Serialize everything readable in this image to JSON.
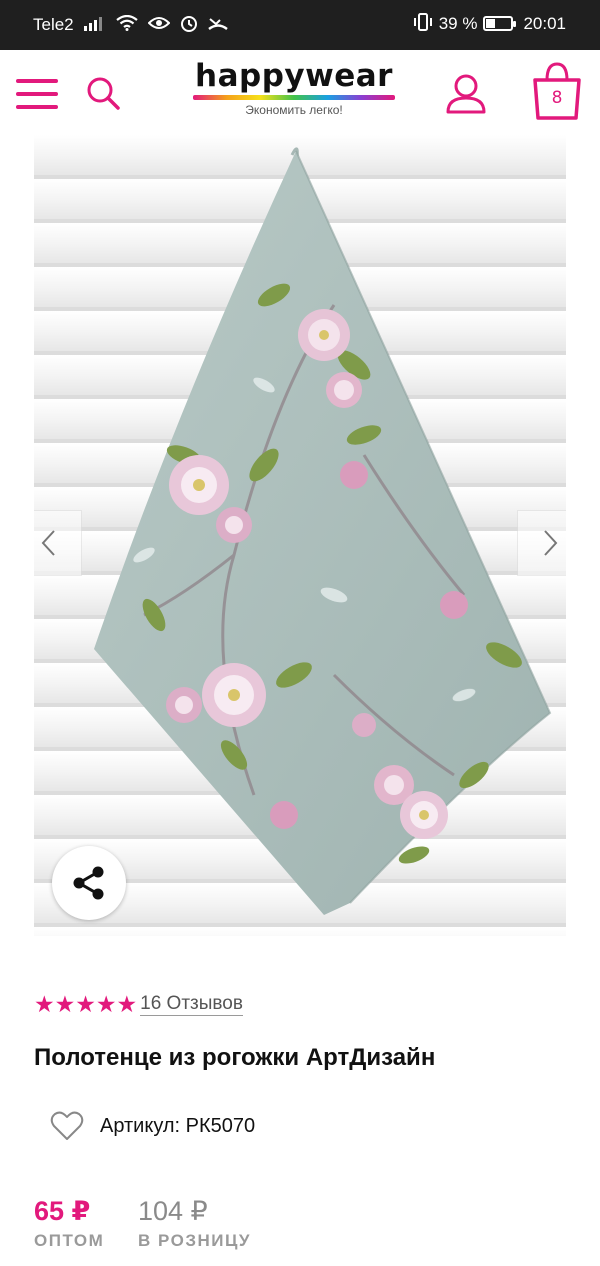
{
  "status_bar": {
    "carrier": "Tele2",
    "battery": "39 %",
    "battery_level": 0.39,
    "time": "20:01",
    "icons": [
      "signal-icon",
      "wifi-icon",
      "eye-comfort-icon",
      "alarm-icon",
      "missed-call-icon",
      "vibrate-icon",
      "battery-icon"
    ]
  },
  "header": {
    "logo_text": "happywear",
    "slogan": "Экономить легко!",
    "cart_count": "8",
    "accent_color": "#e2197c"
  },
  "gallery": {
    "image_subject": "towel-floral-image",
    "prev_icon": "chevron-left-icon",
    "next_icon": "chevron-right-icon",
    "share_icon": "share-icon"
  },
  "product": {
    "rating": 5,
    "reviews_link": "16 Отзывов",
    "title": "Полотенце из рогожки АртДизайн",
    "sku": "Артикул: РК5070"
  },
  "prices": {
    "wholesale": {
      "amount": "65 ₽",
      "caption": "ОПТОМ"
    },
    "retail": {
      "amount": "104 ₽",
      "caption": "В РОЗНИЦУ"
    }
  }
}
